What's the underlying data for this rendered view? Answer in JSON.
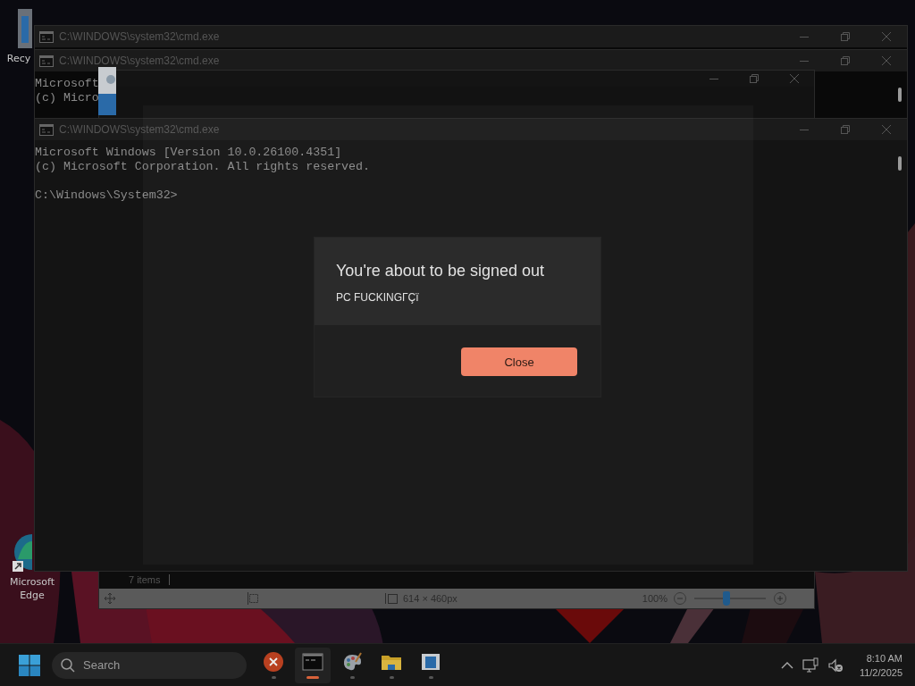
{
  "desktop_icons": [
    {
      "kind": "recycle",
      "label": "Recy"
    },
    {
      "kind": "edge",
      "label": "Microsoft Edge"
    }
  ],
  "windows": [
    {
      "kind": "console",
      "title": "C:\\WINDOWS\\system32\\cmd.exe"
    },
    {
      "kind": "console",
      "title": "C:\\WINDOWS\\system32\\cmd.exe",
      "lines": [
        "Microsoft",
        "(c) Micro"
      ]
    },
    {
      "kind": "paint",
      "status_text": "7 items",
      "canvas_size": "614 × 460px",
      "zoom": "100%",
      "zoom_slider": {
        "level": 0.45
      }
    },
    {
      "kind": "console",
      "title": "C:\\WINDOWS\\system32\\cmd.exe",
      "lines": [
        "Microsoft Windows [Version 10.0.26100.4351]",
        "(c) Microsoft Corporation. All rights reserved."
      ],
      "prompt": "C:\\Windows\\System32>"
    }
  ],
  "dialog": {
    "title": "You're about to be signed out",
    "message": "PC FUCKINGΓÇï",
    "buttons": [
      "Close"
    ]
  },
  "taskbar": {
    "search": {
      "placeholder": "Search"
    },
    "apps": [
      {
        "kind": "error",
        "active": false
      },
      {
        "kind": "terminal",
        "active": true
      },
      {
        "kind": "paint",
        "active": false
      },
      {
        "kind": "folder",
        "active": false
      },
      {
        "kind": "app",
        "active": false
      }
    ],
    "clock": {
      "time": "8:10 AM",
      "date": "11/2/2025"
    }
  }
}
